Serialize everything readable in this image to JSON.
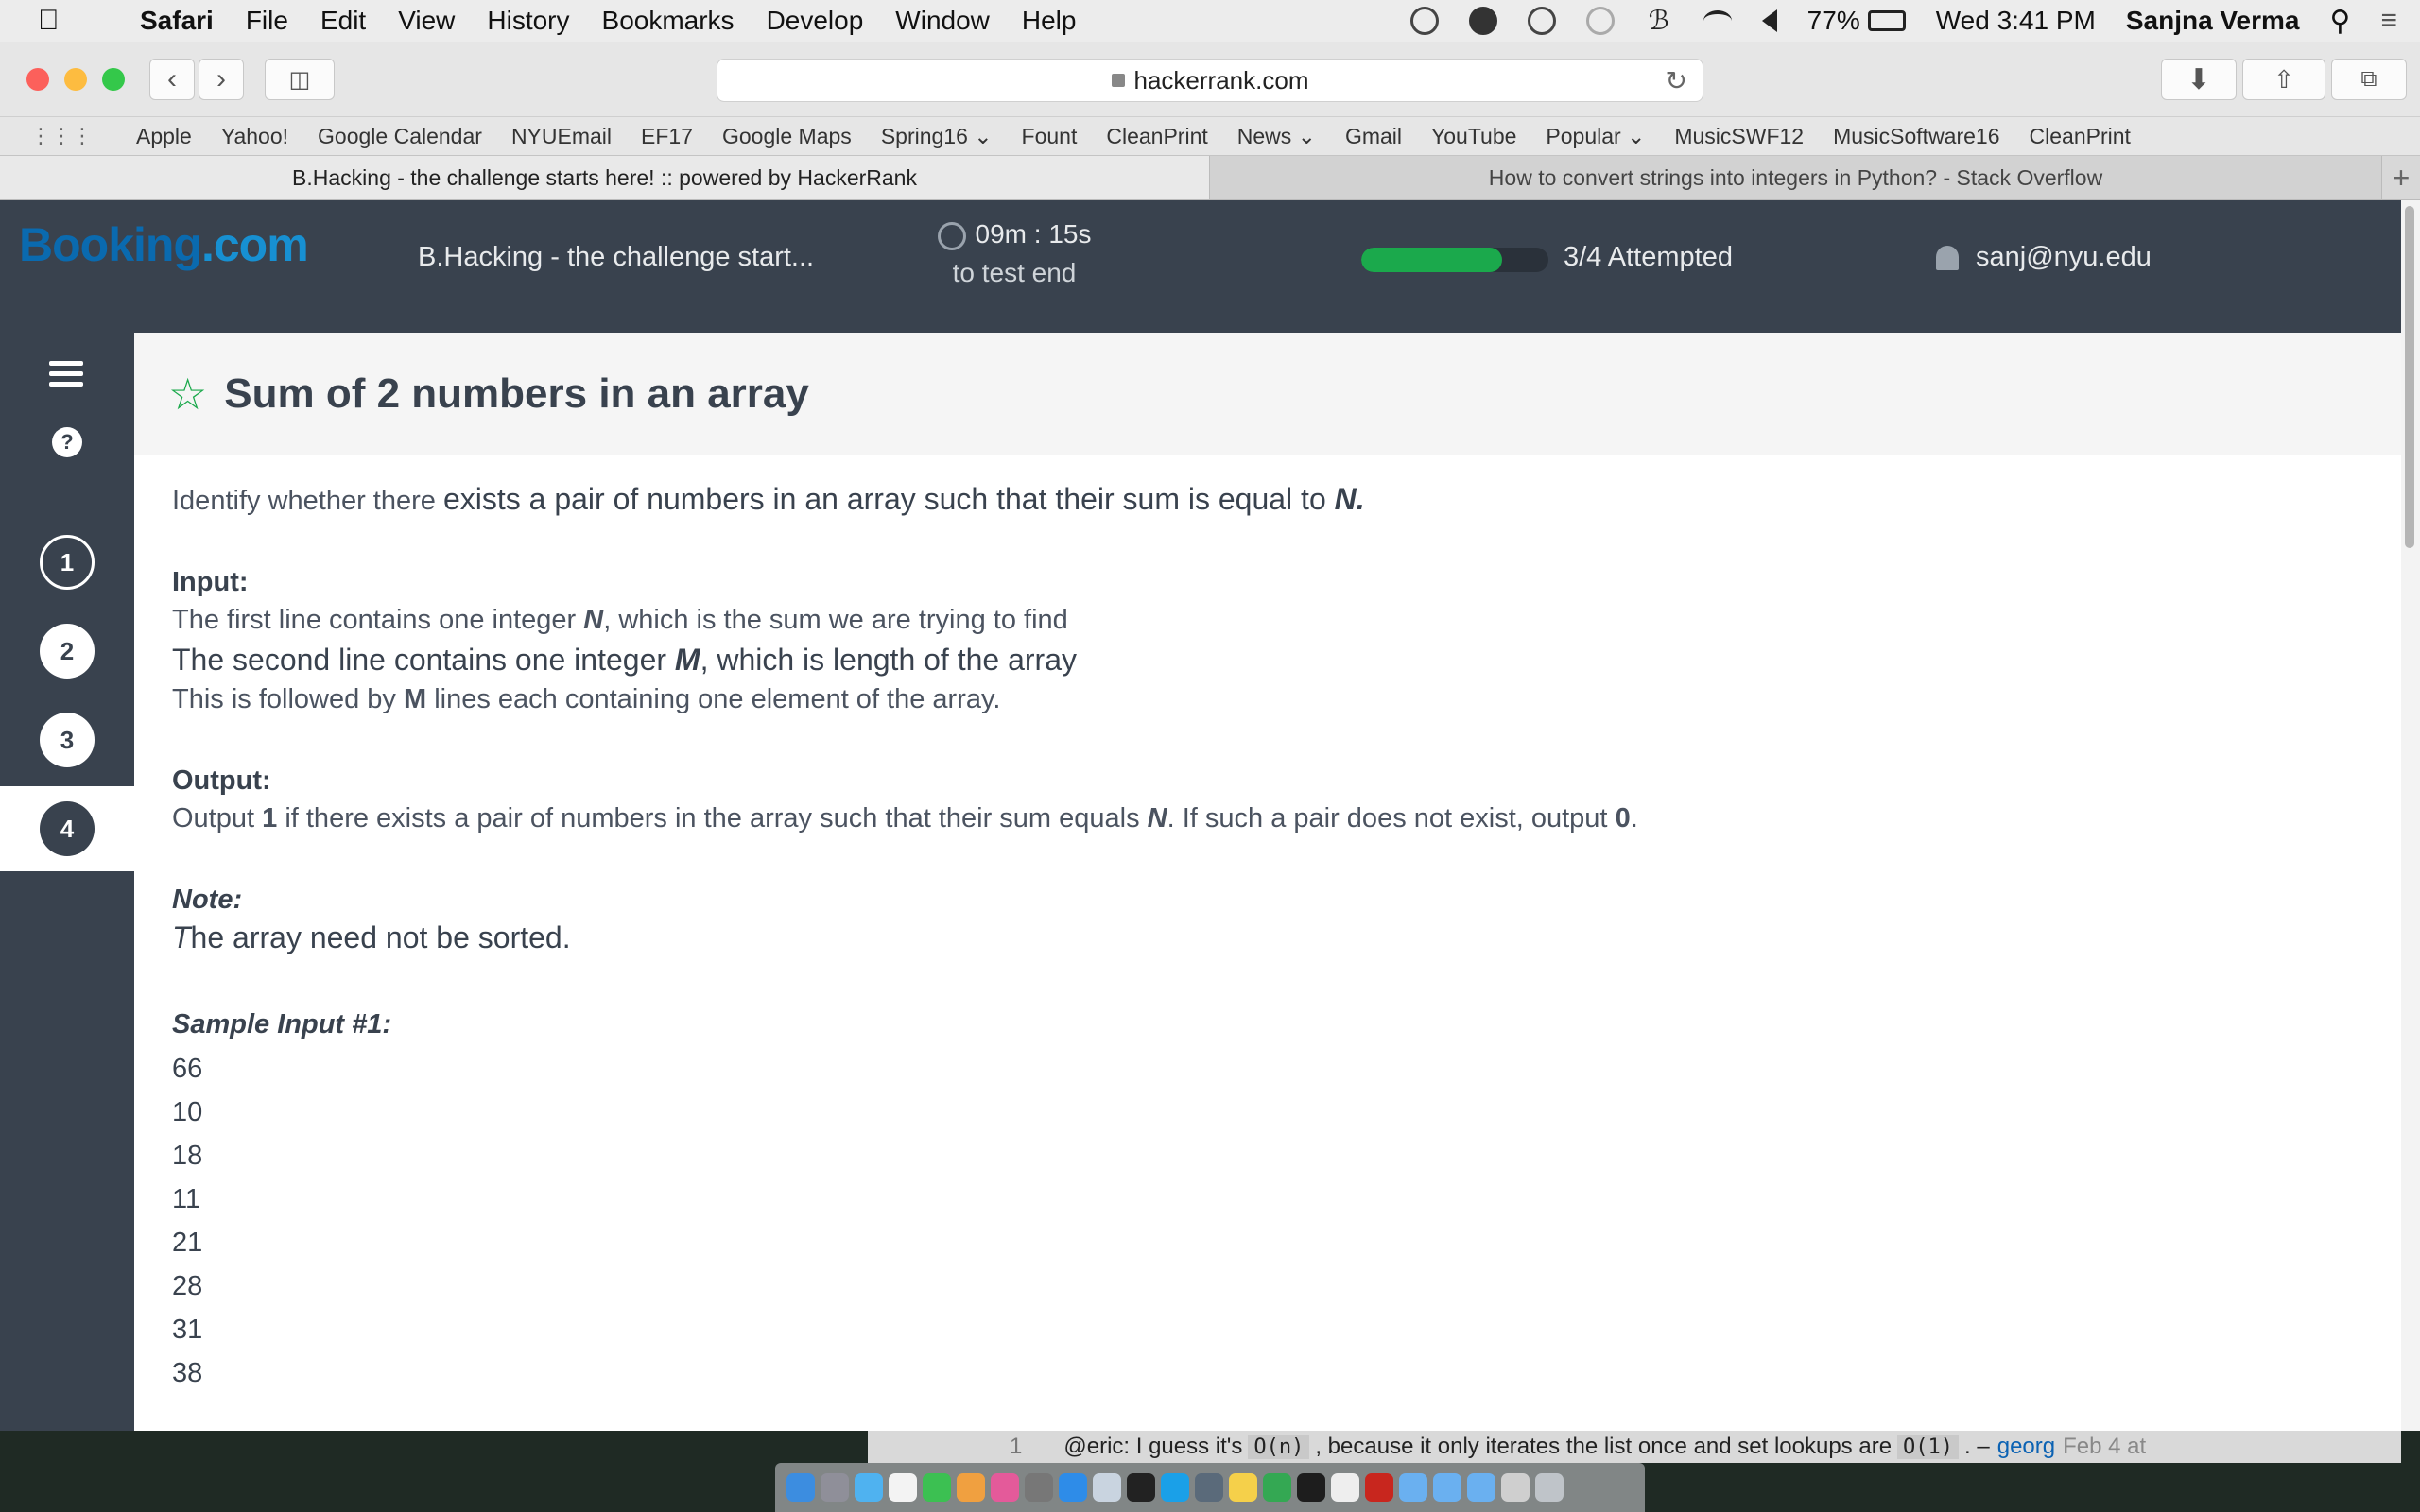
{
  "menubar": {
    "app": "Safari",
    "items": [
      "File",
      "Edit",
      "View",
      "History",
      "Bookmarks",
      "Develop",
      "Window",
      "Help"
    ],
    "battery": "77%",
    "clock": "Wed 3:41 PM",
    "user": "Sanjna Verma"
  },
  "toolbar": {
    "url": "hackerrank.com"
  },
  "bookmarks": [
    "Apple",
    "Yahoo!",
    "Google Calendar",
    "NYUEmail",
    "EF17",
    "Google Maps",
    "Spring16 ⌄",
    "Fount",
    "CleanPrint",
    "News ⌄",
    "Gmail",
    "YouTube",
    "Popular ⌄",
    "MusicSWF12",
    "MusicSoftware16",
    "CleanPrint"
  ],
  "tabs": {
    "active": "B.Hacking - the challenge starts here! :: powered by HackerRank",
    "inactive": "How to convert strings into integers in Python? - Stack Overflow"
  },
  "header": {
    "logo": "Booking",
    "logo_suffix": ".com",
    "test_title": "B.Hacking - the challenge start...",
    "timer": "09m : 15s",
    "timer_sub": "to test end",
    "progress_fraction": 0.75,
    "attempted": "3/4 Attempted",
    "user": "sanj@nyu.edu"
  },
  "nav": {
    "questions": [
      "1",
      "2",
      "3",
      "4"
    ],
    "help": "?"
  },
  "challenge": {
    "title": "Sum of 2 numbers in an array",
    "intro_a": "Identify whether there ",
    "intro_b": "exists a pair of numbers in an array such that their sum is equal to ",
    "intro_n": "N.",
    "input_heading": "Input:",
    "input_line1_a": "The first line contains one integer ",
    "input_line1_n": "N",
    "input_line1_b": ", which is the sum we are trying to find",
    "input_line2_a": "The second line contains one integer ",
    "input_line2_m": "M",
    "input_line2_b": ", which is length of the array",
    "input_line3_a": "This is followed by ",
    "input_line3_m": "M",
    "input_line3_b": " lines each containing one element of the array.",
    "output_heading": "Output:",
    "output_a": "Output ",
    "output_1": "1",
    "output_b": " if there exists a pair of numbers in the array such that their sum equals ",
    "output_n": "N",
    "output_c": ". If such a pair does not exist, output ",
    "output_0": "0",
    "output_d": ".",
    "note_heading": "Note:",
    "note_t": "T",
    "note_rest": "he array need not be sorted.",
    "sample_heading": "Sample Input #1:",
    "sample_values": [
      "66",
      "10",
      "18",
      "11",
      "21",
      "28",
      "31",
      "38"
    ]
  },
  "so_comment": {
    "num": "1",
    "text_a": "@eric: I guess it's",
    "code1": "O(n)",
    "text_b": ", because it only iterates the list once and set lookups are",
    "code2": "O(1)",
    "text_c": ". –",
    "author": "georg",
    "date": "Feb 4 at"
  },
  "colors": {
    "header_bg": "#39424e",
    "accent_green": "#1ba94c",
    "logo_blue": "#0a6aaf"
  }
}
